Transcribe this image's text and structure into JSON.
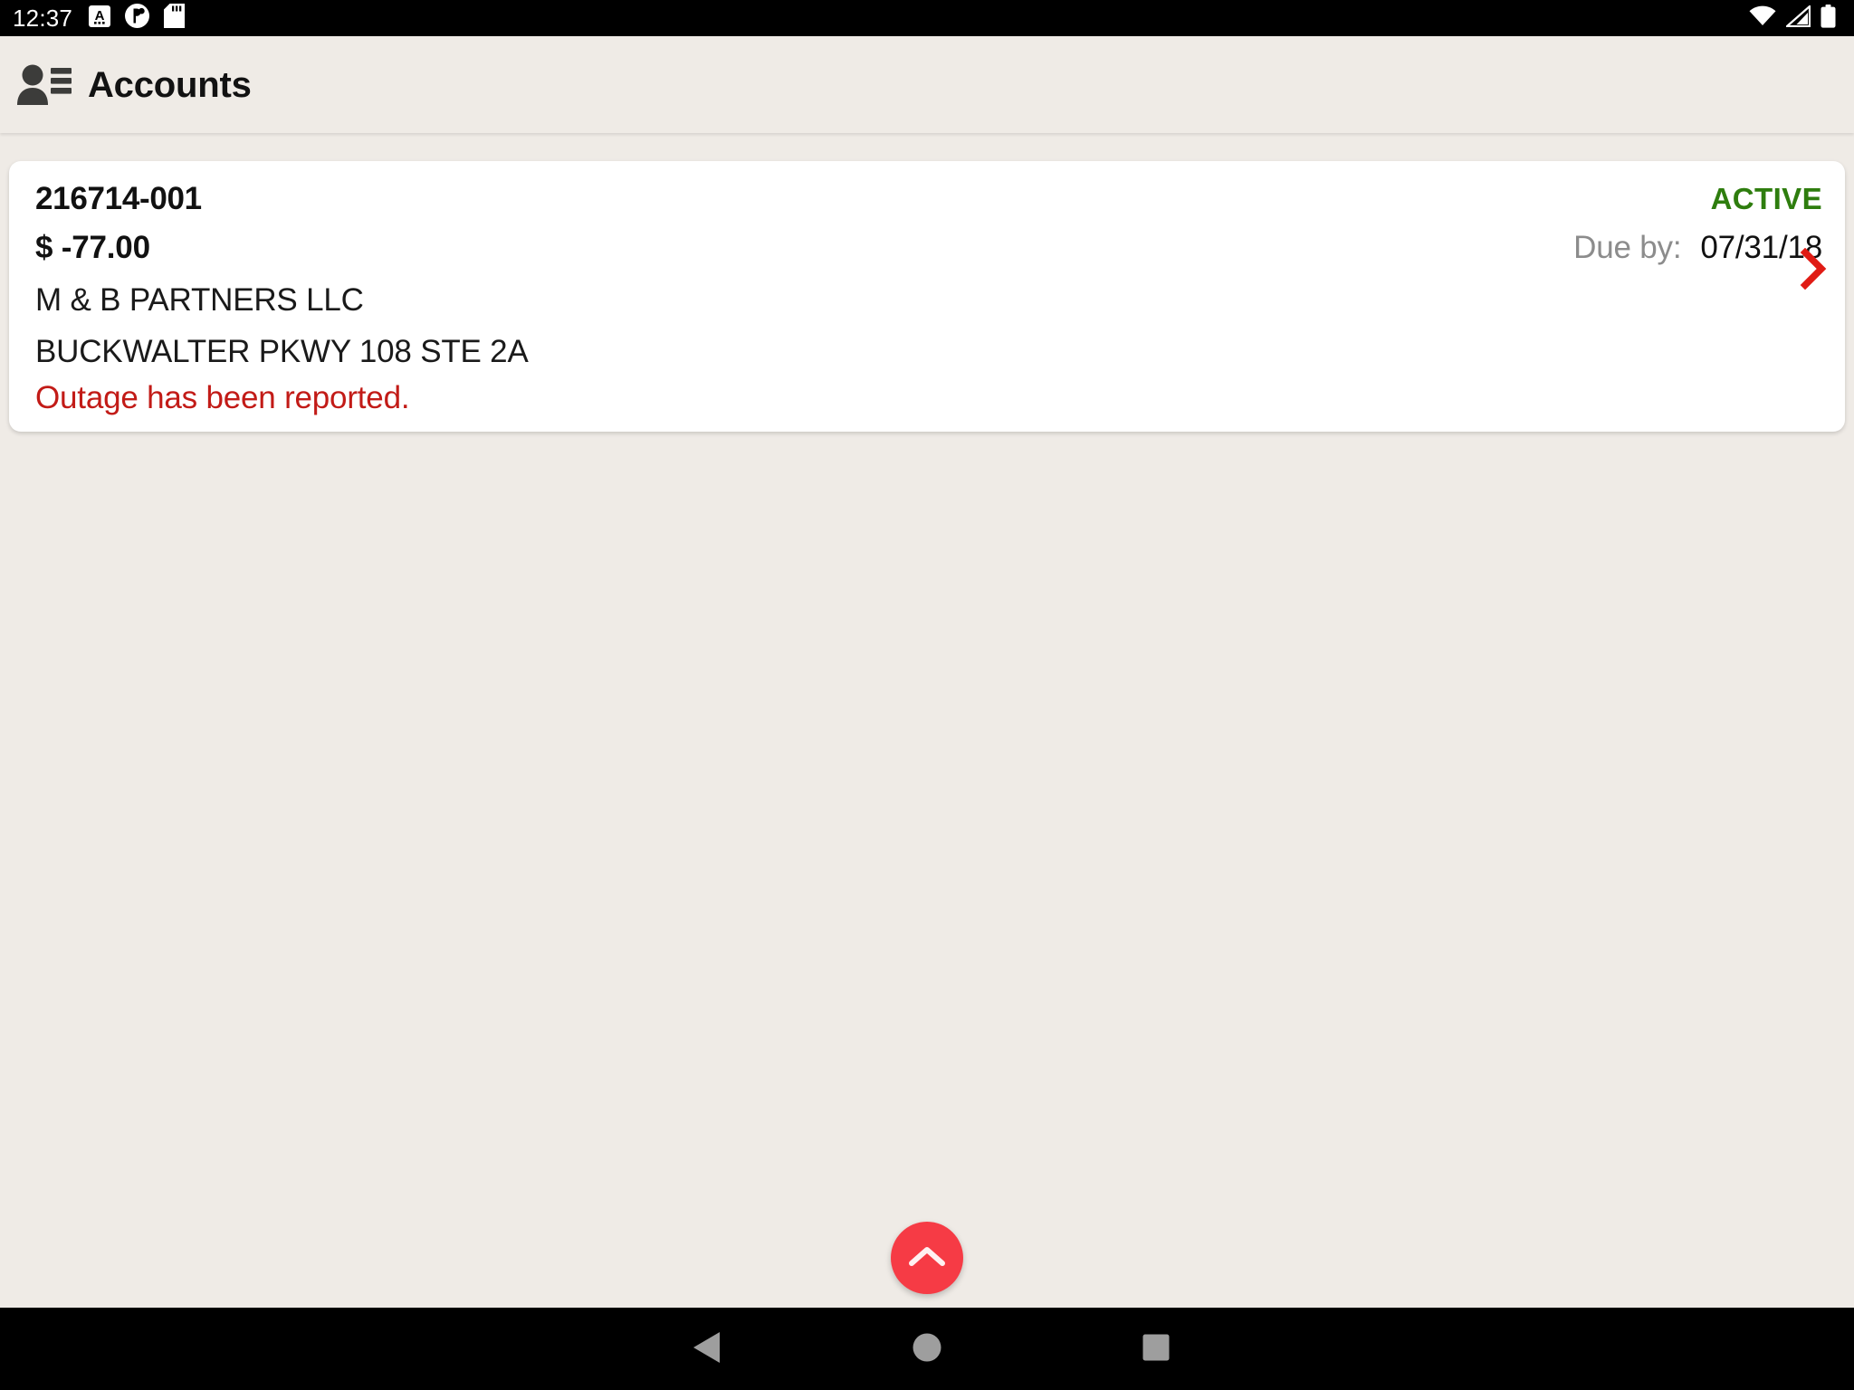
{
  "status_bar": {
    "clock": "12:37",
    "notification_icons": [
      "keyboard-input-icon",
      "app-badge-icon",
      "sd-card-icon"
    ],
    "system_icons": [
      "wifi-icon",
      "cellular-signal-icon",
      "battery-icon"
    ]
  },
  "header": {
    "icon": "accounts-icon",
    "title": "Accounts"
  },
  "accounts": [
    {
      "number": "216714-001",
      "status": "ACTIVE",
      "status_color": "#2E7D0E",
      "balance": "$ -77.00",
      "due_label": "Due by:",
      "due_date": "07/31/18",
      "name": "M & B PARTNERS LLC",
      "address": "BUCKWALTER PKWY 108 STE 2A",
      "alert": "Outage has been reported.",
      "alert_color": "#C21B17",
      "chevron": "chevron-right-icon"
    }
  ],
  "fab": {
    "icon": "chevron-up-icon",
    "color": "#F63B45"
  },
  "nav_bar": {
    "back": "back-triangle-icon",
    "home": "home-circle-icon",
    "recents": "recents-square-icon"
  },
  "theme": {
    "background": "#EFEBE6",
    "card_background": "#FFFFFF",
    "accent_red": "#C21B17"
  }
}
